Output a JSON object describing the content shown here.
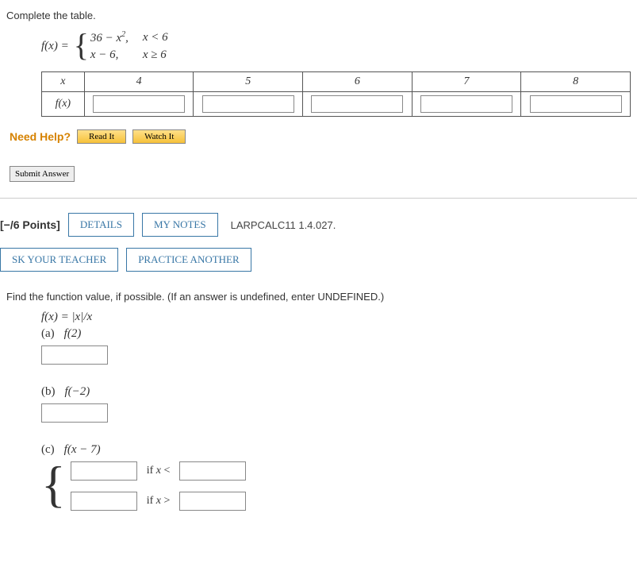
{
  "q1": {
    "prompt": "Complete the table.",
    "lhs": "f(x) = ",
    "pieces": [
      {
        "expr": "36 − x",
        "sup": "2",
        "exprTail": ",",
        "cond": "x < 6"
      },
      {
        "expr": "x − 6,",
        "sup": "",
        "exprTail": "",
        "cond": "x ≥ 6"
      }
    ],
    "row_labels": [
      "x",
      "f(x)"
    ],
    "columns": [
      "4",
      "5",
      "6",
      "7",
      "8"
    ],
    "need_help": "Need Help?",
    "read_it": "Read It",
    "watch_it": "Watch It",
    "submit": "Submit Answer"
  },
  "q2": {
    "points": "[−/6 Points]",
    "details": "DETAILS",
    "mynotes": "MY NOTES",
    "ref": "LARPCALC11 1.4.027.",
    "ask": "SK YOUR TEACHER",
    "practice": "PRACTICE ANOTHER",
    "prompt": "Find the function value, if possible. (If an answer is undefined, enter UNDEFINED.)",
    "fdef": "f(x) = |x|/x",
    "parts": {
      "a": {
        "label": "(a)",
        "fn": "f(2)"
      },
      "b": {
        "label": "(b)",
        "fn": "f(−2)"
      },
      "c": {
        "label": "(c)",
        "fn": "f(x − 7)",
        "cond1_pre": "if ",
        "cond1_var": "x",
        "cond1_op": " <",
        "cond2_pre": "if ",
        "cond2_var": "x",
        "cond2_op": " >"
      }
    }
  }
}
